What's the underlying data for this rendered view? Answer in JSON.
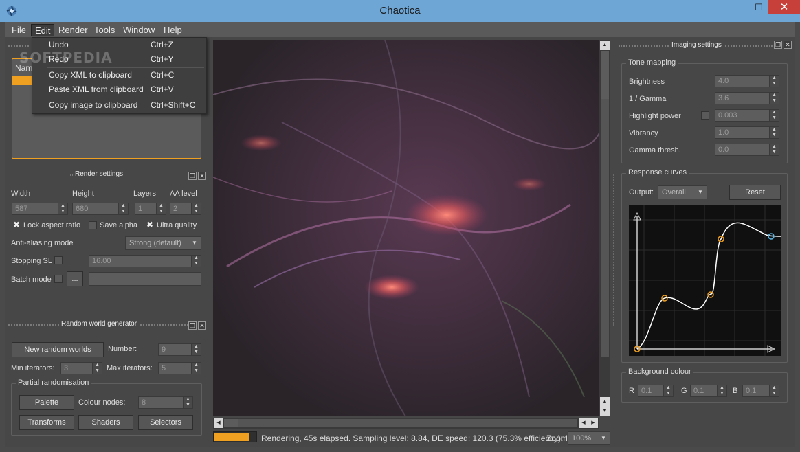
{
  "window": {
    "title": "Chaotica",
    "minimize": "—",
    "maximize": "☐",
    "close": "✕"
  },
  "menubar": {
    "items": [
      "File",
      "Edit",
      "Render",
      "Tools",
      "Window",
      "Help"
    ]
  },
  "edit_menu": {
    "items": [
      {
        "label": "Undo",
        "shortcut": "Ctrl+Z"
      },
      {
        "label": "Redo",
        "shortcut": "Ctrl+Y"
      },
      {
        "label": "Copy XML to clipboard",
        "shortcut": "Ctrl+C"
      },
      {
        "label": "Paste XML from clipboard",
        "shortcut": "Ctrl+V"
      },
      {
        "label": "Copy image to clipboard",
        "shortcut": "Ctrl+Shift+C"
      }
    ]
  },
  "watermark": "SOFTPEDIA",
  "tree": {
    "header": "Nam"
  },
  "render_settings": {
    "title": "Render settings",
    "width_label": "Width",
    "width": "587",
    "height_label": "Height",
    "height": "680",
    "layers_label": "Layers",
    "layers": "1",
    "aa_label": "AA level",
    "aa": "2",
    "lock_aspect": "Lock aspect ratio",
    "lock_aspect_checked": true,
    "save_alpha": "Save alpha",
    "save_alpha_checked": false,
    "ultra_quality": "Ultra quality",
    "ultra_quality_checked": true,
    "aa_mode_label": "Anti-aliasing mode",
    "aa_mode": "Strong (default)",
    "stopping_label": "Stopping SL",
    "stopping": "16.00",
    "batch_label": "Batch mode",
    "batch_btn": "...",
    "batch_value": "."
  },
  "random_world": {
    "title": "Random world generator",
    "new_btn": "New random worlds",
    "number_label": "Number:",
    "number": "9",
    "min_label": "Min iterators:",
    "min": "3",
    "max_label": "Max iterators:",
    "max": "5",
    "partial_title": "Partial randomisation",
    "palette_btn": "Palette",
    "colour_nodes_label": "Colour nodes:",
    "colour_nodes": "8",
    "transforms_btn": "Transforms",
    "shaders_btn": "Shaders",
    "selectors_btn": "Selectors"
  },
  "imaging": {
    "title": "Imaging settings",
    "tone_title": "Tone mapping",
    "brightness_label": "Brightness",
    "brightness": "4.0",
    "gamma_label": "1 / Gamma",
    "gamma": "3.6",
    "highlight_label": "Highlight power",
    "highlight": "0.003",
    "vibrancy_label": "Vibrancy",
    "vibrancy": "1.0",
    "gamma_thresh_label": "Gamma thresh.",
    "gamma_thresh": "0.0",
    "curves_title": "Response curves",
    "output_label": "Output:",
    "output": "Overall",
    "reset_btn": "Reset",
    "bg_title": "Background colour",
    "r_label": "R",
    "r": "0.1",
    "g_label": "G",
    "g": "0.1",
    "b_label": "B",
    "b": "0.1"
  },
  "status": {
    "text": "Rendering, 45s elapsed. Sampling level: 8.84, DE speed: 120.3 (75.3% efficiency). I",
    "zoom_label": "Zoom:",
    "zoom": "100%",
    "progress": 0.8
  },
  "colors": {
    "titlebar": "#6ea6d6",
    "accent": "#f0a020",
    "close": "#c7403a"
  }
}
